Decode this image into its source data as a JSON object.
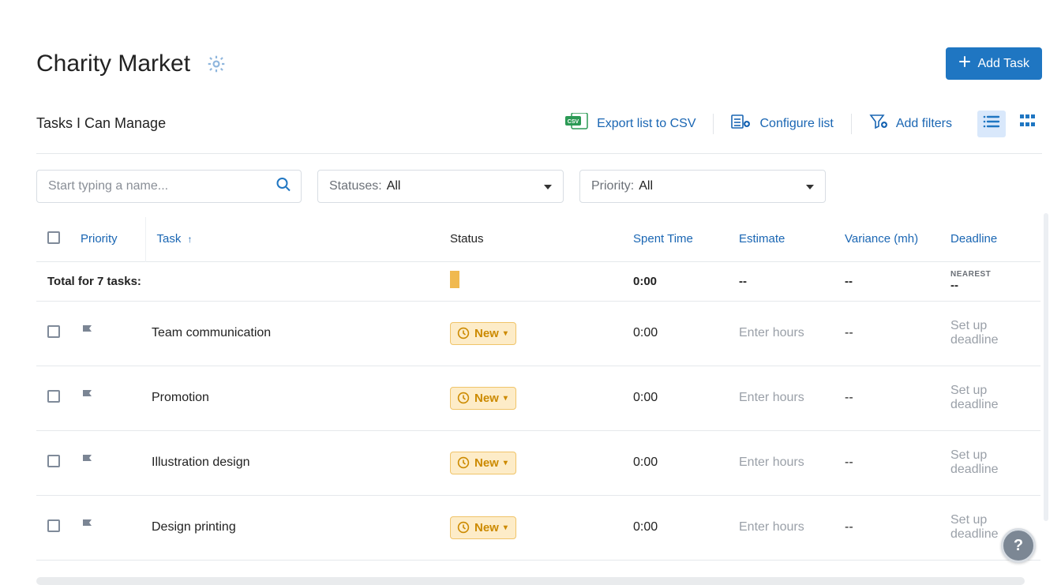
{
  "header": {
    "title": "Charity Market",
    "add_task_label": "Add Task"
  },
  "scope": {
    "label": "Tasks I Can Manage",
    "export_label": "Export list to CSV",
    "configure_label": "Configure list",
    "add_filters_label": "Add filters"
  },
  "filters": {
    "search_placeholder": "Start typing a name...",
    "status_label": "Statuses:",
    "status_value": "All",
    "priority_label": "Priority:",
    "priority_value": "All"
  },
  "columns": {
    "priority": "Priority",
    "task": "Task",
    "status": "Status",
    "spent": "Spent Time",
    "estimate": "Estimate",
    "variance": "Variance (mh)",
    "deadline": "Deadline"
  },
  "totals": {
    "label": "Total for 7 tasks:",
    "spent": "0:00",
    "estimate": "--",
    "variance": "--",
    "nearest_label": "NEAREST",
    "nearest_value": "--"
  },
  "status_pill": {
    "label": "New"
  },
  "placeholders": {
    "estimate": "Enter hours",
    "deadline": "Set up deadline"
  },
  "tasks": [
    {
      "name": "Team communication",
      "spent": "0:00",
      "variance": "--"
    },
    {
      "name": "Promotion",
      "spent": "0:00",
      "variance": "--"
    },
    {
      "name": "Illustration design",
      "spent": "0:00",
      "variance": "--"
    },
    {
      "name": "Design printing",
      "spent": "0:00",
      "variance": "--"
    }
  ],
  "help": {
    "glyph": "?"
  },
  "colors": {
    "accent": "#1f76c2",
    "link": "#1a66b3",
    "status_new_bg": "#fdecc8",
    "status_new_border": "#f0c469",
    "status_new_text": "#cc8a00"
  }
}
